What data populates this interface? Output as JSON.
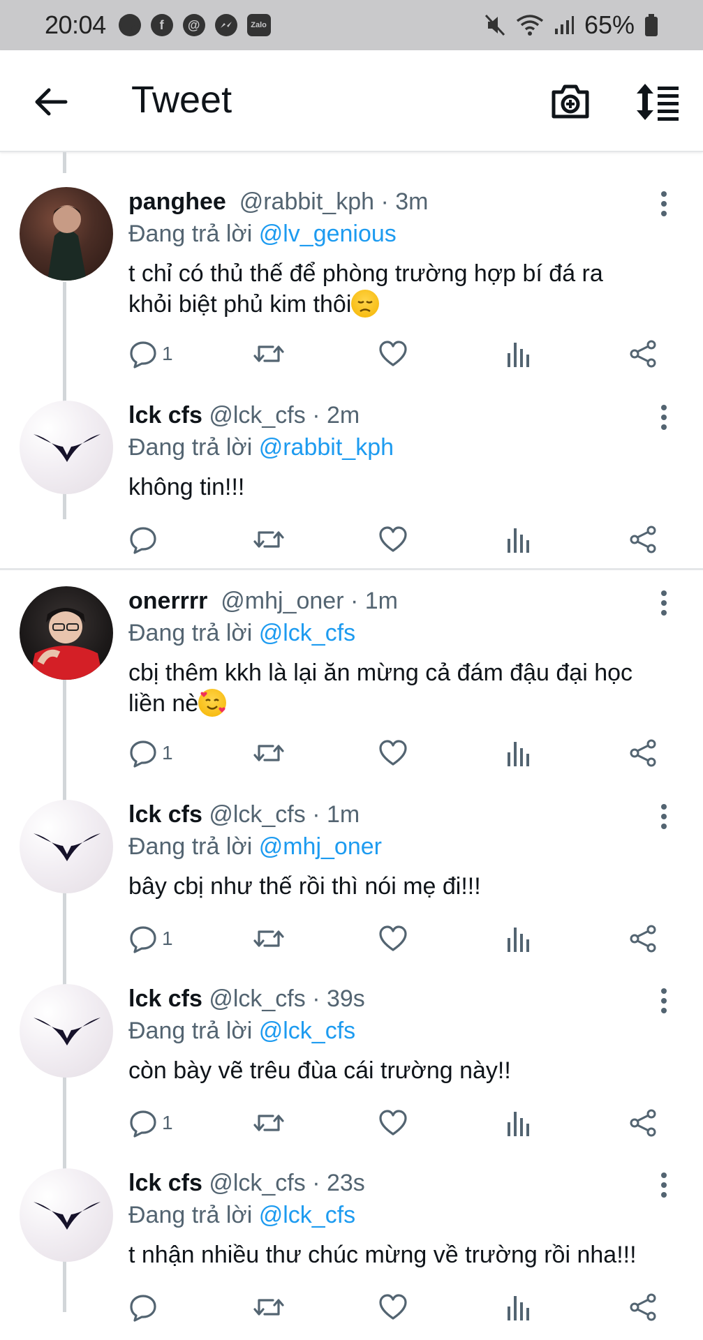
{
  "status_bar": {
    "time": "20:04",
    "battery": "65%"
  },
  "header": {
    "title": "Tweet"
  },
  "reply_prefix": "Đang trả lời",
  "tweets": [
    {
      "name": "panghee",
      "handle": "@rabbit_kph",
      "time": "3m",
      "reply_to": "@lv_genious",
      "text_line1": "t chỉ có thủ thế để phòng trường hợp bí đá ra",
      "text_line2": "khỏi biệt phủ kim thôi",
      "replies": "1"
    },
    {
      "name": "lck cfs",
      "handle": "@lck_cfs",
      "time": "2m",
      "reply_to": "@rabbit_kph",
      "text_line1": "không tin!!!",
      "replies": ""
    },
    {
      "name": "onerrrr",
      "handle": "@mhj_oner",
      "time": "1m",
      "reply_to": "@lck_cfs",
      "text_line1": "cbị thêm kkh là lại ăn mừng cả đám đậu đại học",
      "text_line2": "liền nè",
      "replies": "1"
    },
    {
      "name": "lck cfs",
      "handle": "@lck_cfs",
      "time": "1m",
      "reply_to": "@mhj_oner",
      "text_line1": "bây cbị như thế rồi thì nói mẹ đi!!!",
      "replies": "1"
    },
    {
      "name": "lck cfs",
      "handle": "@lck_cfs",
      "time": "39s",
      "reply_to": "@lck_cfs",
      "text_line1": "còn bày vẽ trêu đùa cái trường này!!",
      "replies": "1"
    },
    {
      "name": "lck cfs",
      "handle": "@lck_cfs",
      "time": "23s",
      "reply_to": "@lck_cfs",
      "text_line1": "t nhận nhiều thư chúc mừng về trường rồi nha!!!",
      "replies": ""
    }
  ],
  "icons": {
    "back": "arrow-left-icon",
    "camera": "camera-plus-icon",
    "sort": "sort-icon",
    "reply": "reply-icon",
    "retweet": "retweet-icon",
    "like": "heart-icon",
    "views": "analytics-icon",
    "share": "share-icon",
    "more": "more-vertical-icon"
  },
  "colors": {
    "mention": "#1d9bf0",
    "secondary": "#536471",
    "thread_line": "#d2d6d9"
  }
}
